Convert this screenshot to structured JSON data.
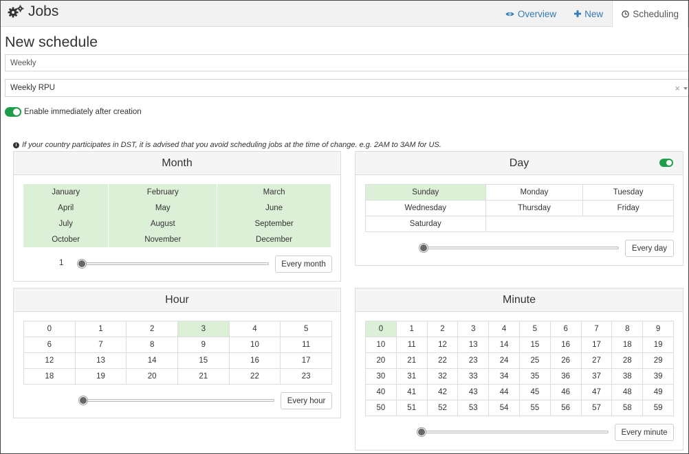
{
  "app": {
    "title": "Jobs",
    "brand_icon": "gears-icon"
  },
  "tabs": [
    {
      "label": "Overview",
      "icon": "eye-icon"
    },
    {
      "label": "New",
      "icon": "plus-icon"
    },
    {
      "label": "Scheduling",
      "icon": "clock-icon",
      "active": true
    }
  ],
  "page": {
    "title": "New schedule"
  },
  "form": {
    "name_value": "Weekly",
    "job_value": "Weekly RPU",
    "clear_glyph": "×",
    "enable_label": "Enable immediately after creation",
    "enable_on": true
  },
  "note": "If your country participates in DST, it is advised that you avoid scheduling jobs at the time of change. e.g. 2AM to 3AM for US.",
  "month": {
    "title": "Month",
    "names": [
      "January",
      "February",
      "March",
      "April",
      "May",
      "June",
      "July",
      "August",
      "September",
      "October",
      "November",
      "December"
    ],
    "selected_all": true,
    "slider_value": "1",
    "slider_level": 0,
    "button": "Every month"
  },
  "day": {
    "title": "Day",
    "enabled": true,
    "names": [
      "Sunday",
      "Monday",
      "Tuesday",
      "Wednesday",
      "Thursday",
      "Friday",
      "Saturday"
    ],
    "selected": [
      "Sunday"
    ],
    "slider_level": 0,
    "button": "Every day"
  },
  "hour": {
    "title": "Hour",
    "values": [
      "0",
      "1",
      "2",
      "3",
      "4",
      "5",
      "6",
      "7",
      "8",
      "9",
      "10",
      "11",
      "12",
      "13",
      "14",
      "15",
      "16",
      "17",
      "18",
      "19",
      "20",
      "21",
      "22",
      "23"
    ],
    "selected": [
      "3"
    ],
    "slider_level": 0,
    "button": "Every hour"
  },
  "minute": {
    "title": "Minute",
    "values": [
      "0",
      "1",
      "2",
      "3",
      "4",
      "5",
      "6",
      "7",
      "8",
      "9",
      "10",
      "11",
      "12",
      "13",
      "14",
      "15",
      "16",
      "17",
      "18",
      "19",
      "20",
      "21",
      "22",
      "23",
      "24",
      "25",
      "26",
      "27",
      "28",
      "29",
      "30",
      "31",
      "32",
      "33",
      "34",
      "35",
      "36",
      "37",
      "38",
      "39",
      "40",
      "41",
      "42",
      "43",
      "44",
      "45",
      "46",
      "47",
      "48",
      "49",
      "50",
      "51",
      "52",
      "53",
      "54",
      "55",
      "56",
      "57",
      "58",
      "59"
    ],
    "selected": [
      "0"
    ],
    "slider_level": 0,
    "button": "Every minute"
  },
  "colors": {
    "accent": "#337ab7",
    "selected_cell": "#dcefd7",
    "toggle_on": "#1e9e4a"
  }
}
